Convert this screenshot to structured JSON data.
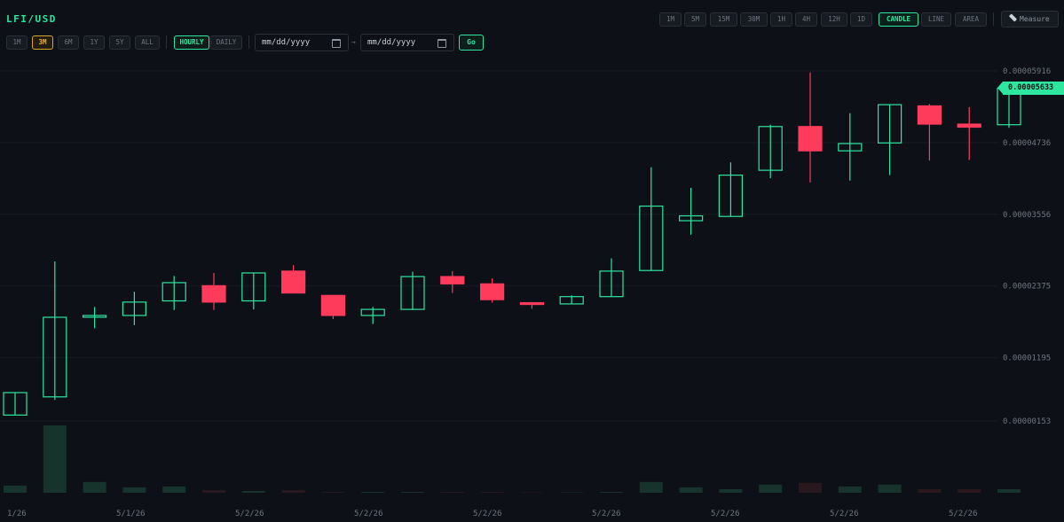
{
  "pair": "LFI/USD",
  "ranges": [
    "1M",
    "3M",
    "6M",
    "1Y",
    "5Y",
    "ALL"
  ],
  "active_range": "3M",
  "resolutions": [
    "HOURLY",
    "DAILY"
  ],
  "active_resolution": "HOURLY",
  "date_from": {
    "placeholder": "mm/dd/yyyy"
  },
  "date_to": {
    "placeholder": "mm/dd/yyyy"
  },
  "range_separator": "→",
  "go_label": "Go",
  "intervals": [
    "1M",
    "5M",
    "15M",
    "30M",
    "1H",
    "4H",
    "12H",
    "1D"
  ],
  "chart_types": [
    "CANDLE",
    "LINE",
    "AREA"
  ],
  "active_chart_type": "CANDLE",
  "measure_label": "Measure",
  "current_price": "0.00005633",
  "colors": {
    "up": "#2ee6a0",
    "down": "#ff3b5c",
    "accent": "#2ee6a0",
    "highlight": "#e3b341",
    "background": "#0d1117"
  },
  "chart_data": {
    "type": "candlestick",
    "y_ticks": [
      "0.00005916",
      "0.00004736",
      "0.00003556",
      "0.00002375",
      "0.00001195",
      "0.00000153"
    ],
    "x_ticks": [
      "1/26",
      "5/1/26",
      "5/2/26",
      "5/2/26",
      "5/2/26",
      "5/2/26",
      "5/2/26",
      "5/2/26",
      "5/2/26"
    ],
    "ylim": [
      1.53e-06,
      5.916e-05
    ],
    "candles": [
      {
        "open": 2.5e-06,
        "high": 6.2e-06,
        "low": 2.5e-06,
        "close": 6.2e-06
      },
      {
        "open": 5.5e-06,
        "high": 2.78e-05,
        "low": 5e-06,
        "close": 1.86e-05
      },
      {
        "open": 1.89e-05,
        "high": 2.03e-05,
        "low": 1.68e-05,
        "close": 1.89e-05
      },
      {
        "open": 1.89e-05,
        "high": 2.28e-05,
        "low": 1.73e-05,
        "close": 2.11e-05
      },
      {
        "open": 2.13e-05,
        "high": 2.54e-05,
        "low": 1.98e-05,
        "close": 2.43e-05
      },
      {
        "open": 2.38e-05,
        "high": 2.59e-05,
        "low": 1.98e-05,
        "close": 2.11e-05
      },
      {
        "open": 2.13e-05,
        "high": 2.59e-05,
        "low": 1.99e-05,
        "close": 2.59e-05
      },
      {
        "open": 2.62e-05,
        "high": 2.72e-05,
        "low": 2.26e-05,
        "close": 2.26e-05
      },
      {
        "open": 2.22e-05,
        "high": 2.14e-05,
        "low": 1.83e-05,
        "close": 1.89e-05
      },
      {
        "open": 1.89e-05,
        "high": 2.03e-05,
        "low": 1.75e-05,
        "close": 1.99e-05
      },
      {
        "open": 1.99e-05,
        "high": 2.61e-05,
        "low": 1.98e-05,
        "close": 2.53e-05
      },
      {
        "open": 2.53e-05,
        "high": 2.62e-05,
        "low": 2.26e-05,
        "close": 2.41e-05
      },
      {
        "open": 2.41e-05,
        "high": 2.5e-05,
        "low": 2.1e-05,
        "close": 2.15e-05
      },
      {
        "open": 2.1e-05,
        "high": 2.11e-05,
        "low": 2e-05,
        "close": 2.08e-05
      },
      {
        "open": 2.08e-05,
        "high": 2.22e-05,
        "low": 2.08e-05,
        "close": 2.2e-05
      },
      {
        "open": 2.2e-05,
        "high": 2.83e-05,
        "low": 2.2e-05,
        "close": 2.62e-05
      },
      {
        "open": 2.63e-05,
        "high": 4.33e-05,
        "low": 2.63e-05,
        "close": 3.69e-05
      },
      {
        "open": 3.45e-05,
        "high": 3.99e-05,
        "low": 3.22e-05,
        "close": 3.53e-05
      },
      {
        "open": 3.52e-05,
        "high": 4.41e-05,
        "low": 3.52e-05,
        "close": 4.2e-05
      },
      {
        "open": 4.28e-05,
        "high": 5.03e-05,
        "low": 4.15e-05,
        "close": 5e-05
      },
      {
        "open": 5e-05,
        "high": 5.89e-05,
        "low": 4.08e-05,
        "close": 4.6e-05
      },
      {
        "open": 4.6e-05,
        "high": 5.22e-05,
        "low": 4.11e-05,
        "close": 4.72e-05
      },
      {
        "open": 4.73e-05,
        "high": 5.36e-05,
        "low": 4.2e-05,
        "close": 5.36e-05
      },
      {
        "open": 5.34e-05,
        "high": 5.37e-05,
        "low": 4.44e-05,
        "close": 5.04e-05
      },
      {
        "open": 5.04e-05,
        "high": 5.32e-05,
        "low": 4.45e-05,
        "close": 4.99e-05
      },
      {
        "open": 5.03e-05,
        "high": 5.71e-05,
        "low": 4.98e-05,
        "close": 5.63e-05
      }
    ],
    "volume": [
      8,
      75,
      12,
      6,
      7,
      3,
      2,
      3,
      1,
      1,
      1,
      1,
      1,
      0.5,
      0.5,
      1,
      12,
      6,
      4,
      9,
      11,
      7,
      9,
      4,
      4,
      4
    ]
  }
}
